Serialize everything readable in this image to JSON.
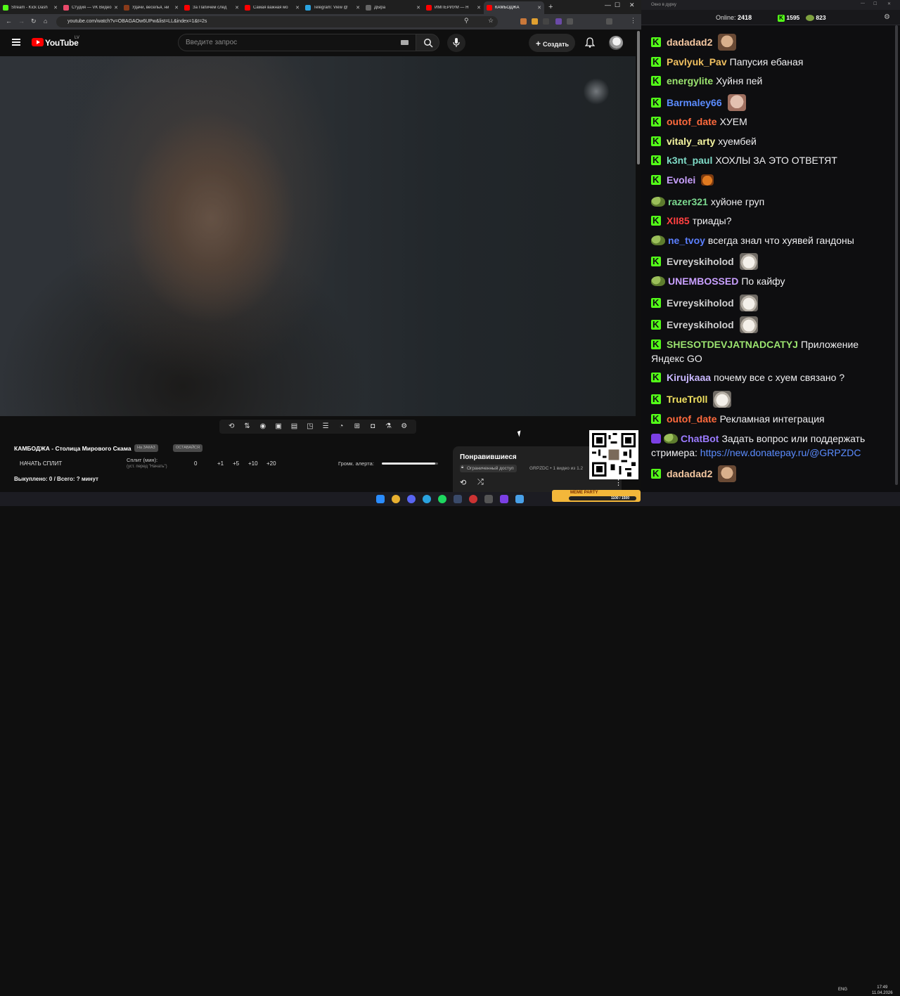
{
  "browser": {
    "tabs": [
      {
        "label": "Stream - Kick Dash",
        "color": "#53fc18",
        "active": false
      },
      {
        "label": "Студия — VK Видео",
        "color": "#e94a6a",
        "active": false
      },
      {
        "label": "Удачи, веселья, ни",
        "color": "#8a3b1a",
        "active": false
      },
      {
        "label": "За Папичем след",
        "color": "#ff0000",
        "active": false
      },
      {
        "label": "Самая важная мо",
        "color": "#ff0000",
        "active": false
      },
      {
        "label": "Telegram: View @",
        "color": "#2aa3e0",
        "active": false
      },
      {
        "label": "ДЫра",
        "color": "#666666",
        "active": false
      },
      {
        "label": "ИМПЕРИУМ — Н",
        "color": "#ff0000",
        "active": false
      },
      {
        "label": "КАМБОДЖА",
        "color": "#ff0000",
        "active": true
      }
    ],
    "url": "youtube.com/watch?v=OBAGAOw6UPw&list=LL&index=1&t=2s"
  },
  "youtube": {
    "logo": "YouTube",
    "region": "LV",
    "search_placeholder": "Введите запрос",
    "create_label": "Создать"
  },
  "stream": {
    "title": "КАМБОДЖА - Столица Мирового Скама",
    "chip1": "На ЗАКАЗ",
    "chip2": "ОСТАВАЙСЯ",
    "split_button": "НАЧАТЬ СПЛИТ",
    "split_label": "Сплит (мин):",
    "split_hint": "(уст. перед \"Начать\")",
    "split_value": "0",
    "increments": [
      "+1",
      "+5",
      "+10",
      "+20"
    ],
    "volume_label": "Громк. алерта:",
    "volume_level": 0.95,
    "bought": "Выкуплено: 0 / Всего: ? минут"
  },
  "liked": {
    "title": "Понравившиеся",
    "badge": "Ограниченный доступ",
    "meta": "GRPZDC • 1 видео из 1.2"
  },
  "chat": {
    "window_title": "Окно в дурку",
    "online_label": "Online:",
    "online_count": "2418",
    "k_count": "1595",
    "p_count": "823",
    "messages": [
      {
        "user": "dadadad2",
        "color": "#f4c7a1",
        "text": "",
        "badge": "k",
        "emote": "face"
      },
      {
        "user": "Pavlyuk_Pav",
        "color": "#f0c060",
        "text": "Папусия ебаная",
        "badge": "k"
      },
      {
        "user": "energylite",
        "color": "#9be36f",
        "text": "Хуйня пей",
        "badge": "k"
      },
      {
        "user": "Barmaley66",
        "color": "#5b8cff",
        "text": "",
        "badge": "k",
        "emote": "face2"
      },
      {
        "user": "outof_date",
        "color": "#ff6a3d",
        "text": "ХУЕМ",
        "badge": "k"
      },
      {
        "user": "vitaly_arty",
        "color": "#f5f5a0",
        "text": "хуембей",
        "badge": "k"
      },
      {
        "user": "k3nt_paul",
        "color": "#7fdcc8",
        "text": "ХОХЛЫ ЗА ЭТО ОТВЕТЯТ",
        "badge": "k"
      },
      {
        "user": "Evolei",
        "color": "#c9a0ff",
        "text": "",
        "badge": "k",
        "emote": "angry"
      },
      {
        "user": "razer321",
        "color": "#7bd88f",
        "text": "хуйоне груп",
        "badge": "pepe"
      },
      {
        "user": "XII85",
        "color": "#ff4040",
        "text": "триады?",
        "badge": "k"
      },
      {
        "user": "ne_tvoy",
        "color": "#5b7fff",
        "text": "всегда знал что хуявей гандоны",
        "badge": "pepe"
      },
      {
        "user": "Evreyskiholod",
        "color": "#d0d0d0",
        "text": "",
        "badge": "k",
        "emote": "cat"
      },
      {
        "user": "UNEMBOSSED",
        "color": "#c9a0ff",
        "text": "По кайфу",
        "badge": "pepe"
      },
      {
        "user": "Evreyskiholod",
        "color": "#d0d0d0",
        "text": "",
        "badge": "k",
        "emote": "cat"
      },
      {
        "user": "Evreyskiholod",
        "color": "#d0d0d0",
        "text": "",
        "badge": "k",
        "emote": "cat"
      },
      {
        "user": "SHESOTDEVJATNADCATYJ",
        "color": "#9be36f",
        "text": "Приложение Яндекс GO",
        "badge": "k"
      },
      {
        "user": "Kirujkaaa",
        "color": "#c9b8ff",
        "text": "почему все с хуем связано ?",
        "badge": "k"
      },
      {
        "user": "TrueTr0ll",
        "color": "#f0e060",
        "text": "",
        "badge": "k",
        "emote": "cat"
      },
      {
        "user": "outof_date",
        "color": "#ff6a3d",
        "text": "Рекламная интеграция",
        "badge": "k"
      },
      {
        "user": "ChatBot",
        "color": "#9b7bff",
        "text": "Задать вопрос или поддержать стримера:",
        "badge": "bot",
        "link": "https://new.donatepay.ru/@GRPZDC"
      },
      {
        "user": "dadadad2",
        "color": "#f4c7a1",
        "text": "",
        "badge": "k",
        "emote": "face"
      }
    ]
  },
  "meme_widget": {
    "title": "MEME PARTY",
    "progress": "1100 / 1500"
  },
  "taskbar": {
    "lang": "ENG",
    "time": "17:49",
    "date": "11.04.2026"
  }
}
